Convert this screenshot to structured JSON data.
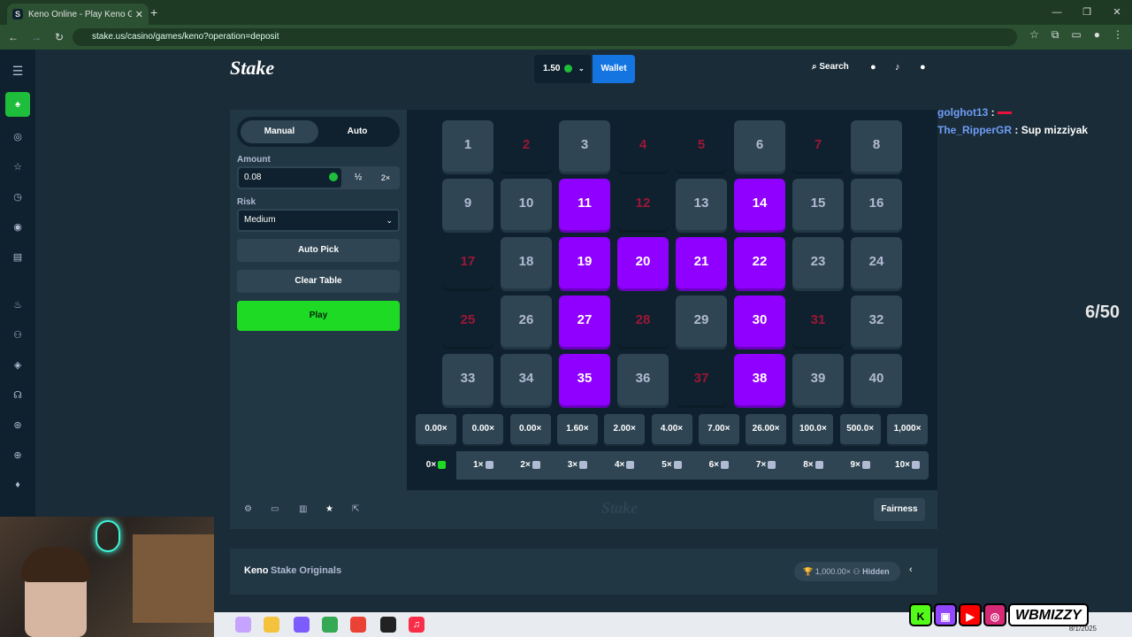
{
  "browser": {
    "tab_title": "Keno Online - Play Keno Game",
    "tab_favicon": "S",
    "url": "stake.us/casino/games/keno?operation=deposit"
  },
  "topnav": {
    "logo": "Stake",
    "balance": "1.50",
    "wallet": "Wallet",
    "search": "Search"
  },
  "chat": [
    {
      "user": "golghot13",
      "sep": " : ",
      "msg": ""
    },
    {
      "user": "The_RipperGR",
      "sep": " : ",
      "msg": "Sup mizziyak"
    }
  ],
  "counter": "6/50",
  "controls": {
    "mode_manual": "Manual",
    "mode_auto": "Auto",
    "amount_label": "Amount",
    "amount_value": "0.08",
    "half": "½",
    "double": "2×",
    "risk_label": "Risk",
    "risk_value": "Medium",
    "auto_pick": "Auto Pick",
    "clear_table": "Clear Table",
    "play": "Play"
  },
  "tiles": [
    {
      "n": "1",
      "state": "n"
    },
    {
      "n": "2",
      "state": "m"
    },
    {
      "n": "3",
      "state": "n"
    },
    {
      "n": "4",
      "state": "m"
    },
    {
      "n": "5",
      "state": "m"
    },
    {
      "n": "6",
      "state": "n"
    },
    {
      "n": "7",
      "state": "m"
    },
    {
      "n": "8",
      "state": "n"
    },
    {
      "n": "9",
      "state": "n"
    },
    {
      "n": "10",
      "state": "n"
    },
    {
      "n": "11",
      "state": "s"
    },
    {
      "n": "12",
      "state": "m"
    },
    {
      "n": "13",
      "state": "n"
    },
    {
      "n": "14",
      "state": "s"
    },
    {
      "n": "15",
      "state": "n"
    },
    {
      "n": "16",
      "state": "n"
    },
    {
      "n": "17",
      "state": "m"
    },
    {
      "n": "18",
      "state": "n"
    },
    {
      "n": "19",
      "state": "s"
    },
    {
      "n": "20",
      "state": "s"
    },
    {
      "n": "21",
      "state": "s"
    },
    {
      "n": "22",
      "state": "s"
    },
    {
      "n": "23",
      "state": "n"
    },
    {
      "n": "24",
      "state": "n"
    },
    {
      "n": "25",
      "state": "m"
    },
    {
      "n": "26",
      "state": "n"
    },
    {
      "n": "27",
      "state": "s"
    },
    {
      "n": "28",
      "state": "m"
    },
    {
      "n": "29",
      "state": "n"
    },
    {
      "n": "30",
      "state": "s"
    },
    {
      "n": "31",
      "state": "m"
    },
    {
      "n": "32",
      "state": "n"
    },
    {
      "n": "33",
      "state": "n"
    },
    {
      "n": "34",
      "state": "n"
    },
    {
      "n": "35",
      "state": "s"
    },
    {
      "n": "36",
      "state": "n"
    },
    {
      "n": "37",
      "state": "m"
    },
    {
      "n": "38",
      "state": "s"
    },
    {
      "n": "39",
      "state": "n"
    },
    {
      "n": "40",
      "state": "n"
    }
  ],
  "multipliers": [
    "0.00×",
    "0.00×",
    "0.00×",
    "1.60×",
    "2.00×",
    "4.00×",
    "7.00×",
    "26.00×",
    "100.0×",
    "500.0×",
    "1,000×"
  ],
  "hits": [
    "0×",
    "1×",
    "2×",
    "3×",
    "4×",
    "5×",
    "6×",
    "7×",
    "8×",
    "9×",
    "10×"
  ],
  "footer": {
    "logo": "Stake",
    "fairness": "Fairness"
  },
  "info": {
    "title": "Keno",
    "subtitle": "Stake Originals",
    "max": "1,000.00×",
    "hidden": "Hidden"
  },
  "taskbar": {
    "date": "8/1/2025"
  },
  "socials": {
    "handle": "WBMIZZY"
  },
  "colors": {
    "selected": "#9000ff",
    "play": "#1fda25",
    "wallet": "#1475e1",
    "bg": "#1a2c38"
  }
}
